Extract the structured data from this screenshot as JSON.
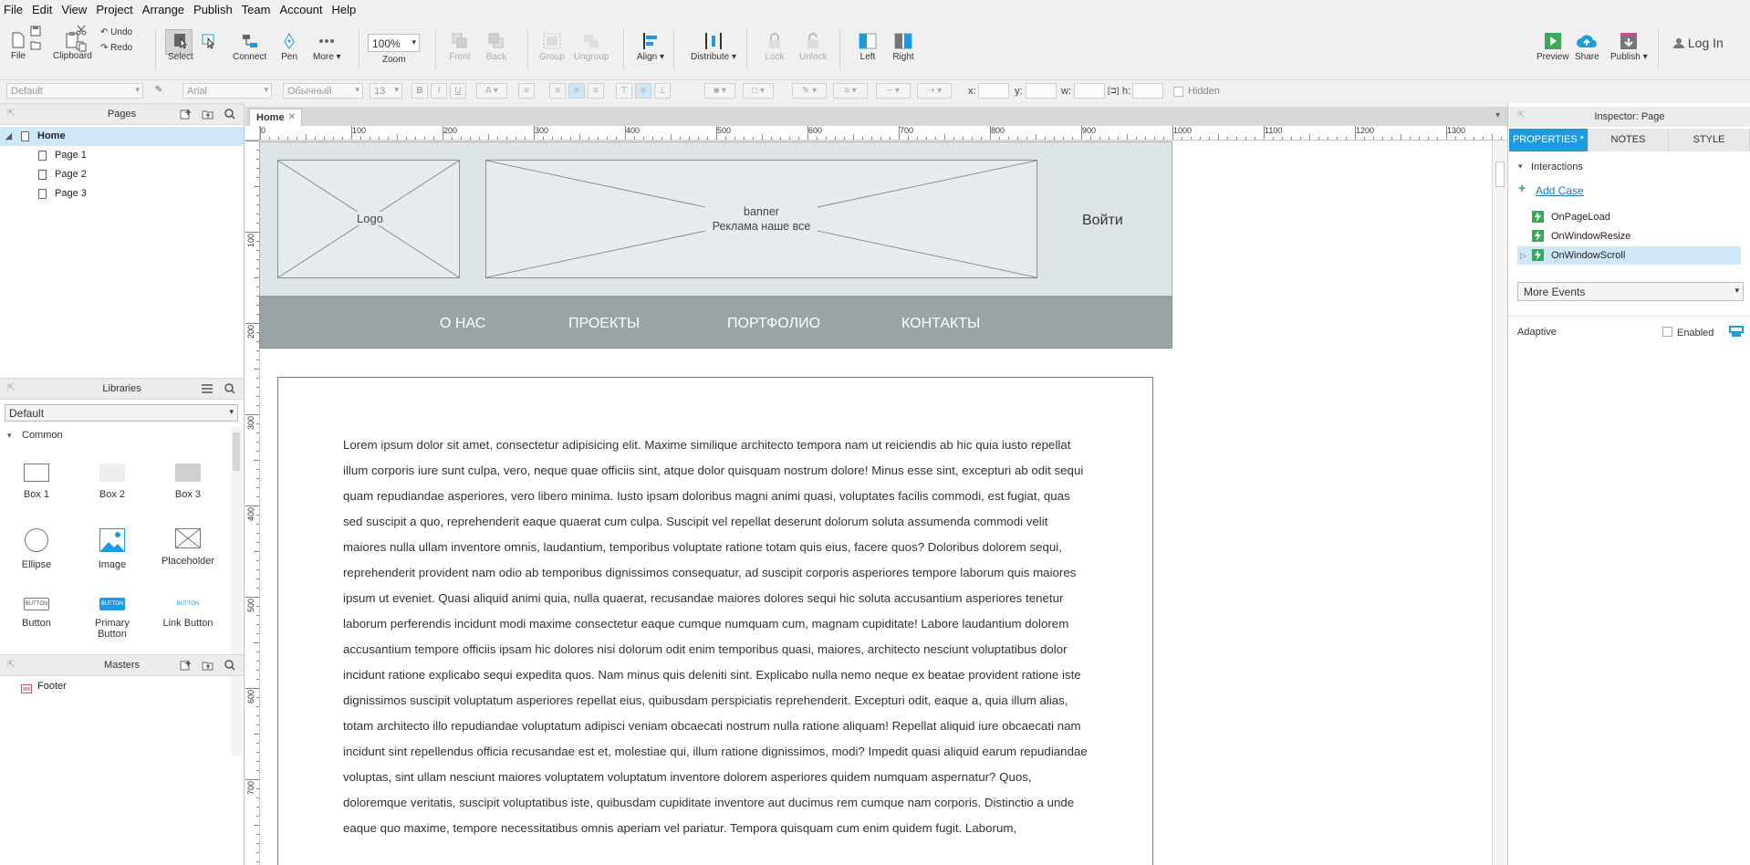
{
  "menu": [
    "File",
    "Edit",
    "View",
    "Project",
    "Arrange",
    "Publish",
    "Team",
    "Account",
    "Help"
  ],
  "toolbar": {
    "file": "File",
    "clipboard": "Clipboard",
    "undo": "Undo",
    "redo": "Redo",
    "select": "Select",
    "connect": "Connect",
    "pen": "Pen",
    "more": "More ▾",
    "zoom_value": "100%",
    "zoom_label": "Zoom",
    "front": "Front",
    "back": "Back",
    "group": "Group",
    "ungroup": "Ungroup",
    "align": "Align ▾",
    "distribute": "Distribute ▾",
    "lock": "Lock",
    "unlock": "Unlock",
    "left": "Left",
    "right": "Right",
    "preview": "Preview",
    "share": "Share",
    "publish": "Publish ▾",
    "login": "Log In"
  },
  "formatbar": {
    "style": "Default",
    "font": "Arial",
    "weight": "Обычный",
    "size": "13",
    "x_label": "x:",
    "y_label": "y:",
    "w_label": "w:",
    "h_label": "h:",
    "hidden": "Hidden"
  },
  "pages_panel": {
    "title": "Pages",
    "items": [
      "Home",
      "Page 1",
      "Page 2",
      "Page 3"
    ]
  },
  "libraries_panel": {
    "title": "Libraries",
    "selected": "Default",
    "group": "Common",
    "items": [
      "Box 1",
      "Box 2",
      "Box 3",
      "Ellipse",
      "Image",
      "Placeholder",
      "Button",
      "Primary Button",
      "Link Button"
    ],
    "button_text": "BUTTON"
  },
  "masters_panel": {
    "title": "Masters",
    "items": [
      "Footer"
    ]
  },
  "canvas": {
    "tab": "Home",
    "ruler_h": [
      "0",
      "100",
      "200",
      "300",
      "400",
      "500",
      "600",
      "700",
      "800",
      "900",
      "1000",
      "1100",
      "1200",
      "1300"
    ],
    "ruler_v": [
      "100",
      "200",
      "300",
      "400",
      "500",
      "600",
      "700"
    ],
    "logo": "Logo",
    "banner_line1": "banner",
    "banner_line2": "Реклама наше все",
    "login": "Войти",
    "nav": [
      "О НАС",
      "ПРОЕКТЫ",
      "ПОРТФОЛИО",
      "КОНТАКТЫ"
    ],
    "lorem": "Lorem ipsum dolor sit amet, consectetur adipisicing elit. Maxime similique architecto tempora nam ut reiciendis ab hic quia iusto repellat illum corporis iure sunt culpa, vero, neque quae officiis sint, atque dolor quisquam nostrum dolore! Minus esse sint, excepturi ab odit sequi quam repudiandae asperiores, vero libero minima. Iusto ipsam doloribus magni animi quasi, voluptates facilis commodi, est fugiat, quas sed suscipit a quo, reprehenderit eaque quaerat cum culpa. Suscipit vel repellat deserunt dolorum soluta assumenda commodi velit maiores nulla ullam inventore omnis, laudantium, temporibus voluptate ratione totam quis eius, facere quos? Doloribus dolorem sequi, reprehenderit provident nam odio ab temporibus dignissimos consequatur, ad suscipit corporis asperiores tempore laborum quis maiores ipsum ut eveniet. Quasi aliquid animi quia, nulla quaerat, recusandae maiores dolores sequi hic soluta accusantium asperiores tenetur laborum perferendis incidunt modi maxime consectetur eaque cumque numquam cum, magnam cupiditate! Labore laudantium dolorem accusantium tempore officiis ipsam hic dolores nisi dolorum odit enim temporibus quasi, maiores, architecto nesciunt voluptatibus dolor incidunt ratione explicabo sequi expedita quos. Nam minus quis deleniti sint. Explicabo nulla nemo neque ex beatae provident ratione iste dignissimos suscipit voluptatum asperiores repellat eius, quibusdam perspiciatis reprehenderit. Excepturi odit, eaque a, quia illum alias, totam architecto illo repudiandae voluptatum adipisci veniam obcaecati nostrum nulla ratione aliquam! Repellat aliquid iure obcaecati nam incidunt sint repellendus officia recusandae est et, molestiae qui, illum ratione dignissimos, modi? Impedit quasi aliquid earum repudiandae voluptas, sint ullam nesciunt maiores voluptatem voluptatum inventore dolorem asperiores quidem numquam aspernatur? Quos, doloremque veritatis, suscipit voluptatibus iste, quibusdam cupiditate inventore aut ducimus rem cumque nam corporis. Distinctio a unde eaque quo maxime, tempore necessitatibus omnis aperiam vel pariatur. Tempora quisquam cum enim quidem fugit. Laborum,"
  },
  "inspector": {
    "title": "Inspector: Page",
    "tabs": [
      "PROPERTIES *",
      "NOTES",
      "STYLE"
    ],
    "interactions": "Interactions",
    "add_case": "Add Case",
    "events": [
      "OnPageLoad",
      "OnWindowResize",
      "OnWindowScroll"
    ],
    "more_events": "More Events",
    "adaptive": "Adaptive",
    "enabled": "Enabled"
  },
  "colors": {
    "accent": "#1e9be0",
    "header_bg": "#dde4e6",
    "nav_bg": "#9aa3a5",
    "selection": "#cfe8f7"
  }
}
